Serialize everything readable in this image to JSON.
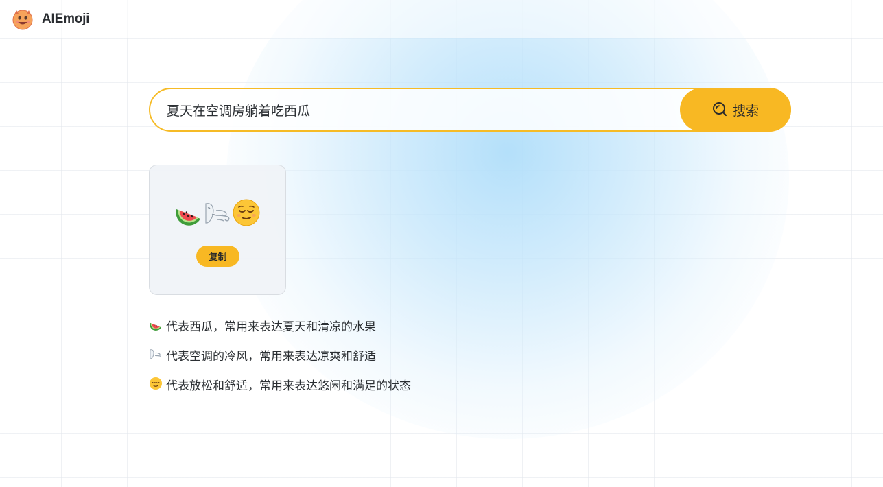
{
  "header": {
    "app_title": "AIEmoji",
    "logo_icon": "smiling-devil-face-icon"
  },
  "search": {
    "value": "夏天在空调房躺着吃西瓜",
    "button_label": "搜索",
    "button_icon": "search-icon"
  },
  "result": {
    "emojis": [
      "watermelon-icon",
      "wind-face-icon",
      "relieved-face-icon"
    ],
    "copy_label": "复制"
  },
  "explanations": [
    {
      "icon": "watermelon-icon",
      "text": "代表西瓜，常用来表达夏天和清凉的水果"
    },
    {
      "icon": "wind-face-icon",
      "text": "代表空调的冷风，常用来表达凉爽和舒适"
    },
    {
      "icon": "relieved-face-icon",
      "text": "代表放松和舒适，常用来表达悠闲和满足的状态"
    }
  ],
  "colors": {
    "accent": "#f8b823",
    "accent_border": "#f6bb26",
    "glow": "#b0defa"
  }
}
